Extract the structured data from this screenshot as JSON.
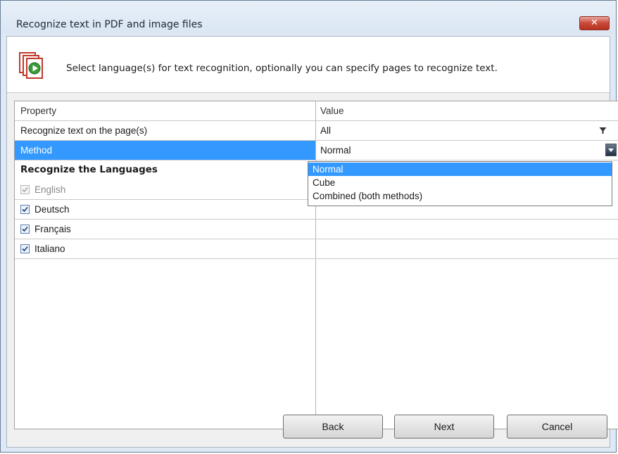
{
  "window": {
    "title": "Recognize text in PDF and image files",
    "close_label": "✕"
  },
  "header": {
    "instruction": "Select language(s) for text recognition, optionally you can specify pages to recognize text."
  },
  "grid": {
    "columns": [
      "Property",
      "Value"
    ],
    "pages_row": {
      "label": "Recognize text on the page(s)",
      "value": "All"
    },
    "method_row": {
      "label": "Method",
      "value": "Normal"
    },
    "languages_heading": "Recognize the Languages",
    "languages": [
      {
        "label": "English",
        "checked": true,
        "enabled": false
      },
      {
        "label": "Deutsch",
        "checked": true,
        "enabled": true
      },
      {
        "label": "Français",
        "checked": true,
        "enabled": true
      },
      {
        "label": "Italiano",
        "checked": true,
        "enabled": true
      }
    ]
  },
  "method_dropdown": {
    "options": [
      "Normal",
      "Cube",
      "Combined (both methods)"
    ],
    "selected": "Normal"
  },
  "buttons": {
    "back": "Back",
    "next": "Next",
    "cancel": "Cancel"
  },
  "colors": {
    "selection": "#3399ff",
    "close_button": "#c9493a"
  },
  "icons": {
    "header": "pdf-pages-play-icon",
    "filter": "filter-icon",
    "dropdown": "chevron-down-icon",
    "check": "checkmark-icon"
  }
}
